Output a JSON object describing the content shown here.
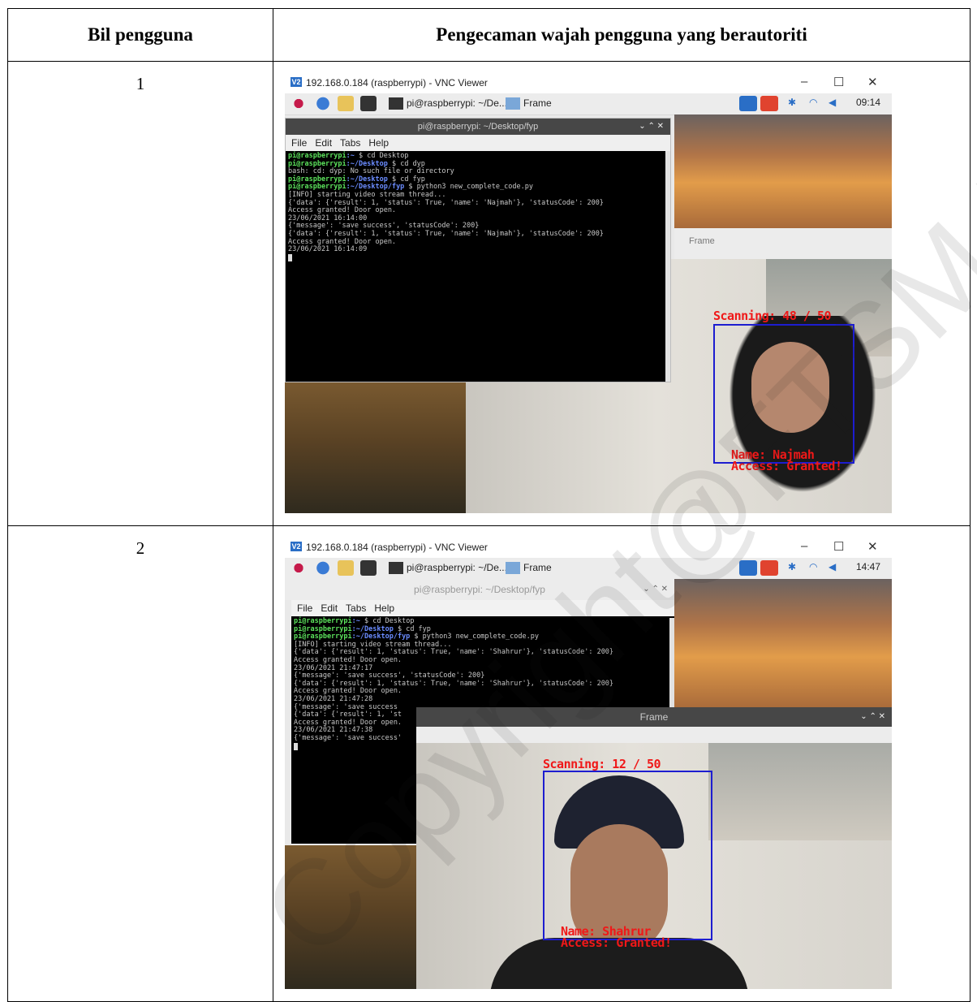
{
  "table": {
    "col1_header": "Bil pengguna",
    "col2_header": "Pengecaman wajah pengguna yang berautoriti"
  },
  "rows": [
    {
      "number": "1",
      "vnc_title": "192.168.0.184 (raspberrypi) - VNC Viewer",
      "taskbar_terminal": "pi@raspberrypi: ~/De...",
      "taskbar_frame": "Frame",
      "clock": "09:14",
      "terminal_title": "pi@raspberrypi: ~/Desktop/fyp",
      "terminal_menu": [
        "File",
        "Edit",
        "Tabs",
        "Help"
      ],
      "terminal_lines": [
        {
          "prompt": "pi@raspberrypi",
          "path": ":~",
          "cmd": " $ cd Desktop"
        },
        {
          "prompt": "pi@raspberrypi",
          "path": ":~/Desktop",
          "cmd": " $ cd dyp"
        },
        {
          "text": "bash: cd: dyp: No such file or directory"
        },
        {
          "prompt": "pi@raspberrypi",
          "path": ":~/Desktop",
          "cmd": " $ cd fyp"
        },
        {
          "prompt": "pi@raspberrypi",
          "path": ":~/Desktop/fyp",
          "cmd": " $ python3 new_complete_code.py"
        },
        {
          "text": "[INFO] starting video stream thread..."
        },
        {
          "text": "{'data': {'result': 1, 'status': True, 'name': 'Najmah'}, 'statusCode': 200}"
        },
        {
          "text": "Access granted! Door open."
        },
        {
          "text": "23/06/2021 16:14:00"
        },
        {
          "text": "{'message': 'save success', 'statusCode': 200}"
        },
        {
          "text": "{'data': {'result': 1, 'status': True, 'name': 'Najmah'}, 'statusCode': 200}"
        },
        {
          "text": "Access granted! Door open."
        },
        {
          "text": "23/06/2021 16:14:09"
        }
      ],
      "frame_label": "Frame",
      "overlay_scanning": "Scanning: 48 / 50",
      "overlay_name": "Name: Najmah",
      "overlay_access": "Access: Granted!"
    },
    {
      "number": "2",
      "vnc_title": "192.168.0.184 (raspberrypi) - VNC Viewer",
      "taskbar_terminal": "pi@raspberrypi: ~/De...",
      "taskbar_frame": "Frame",
      "clock": "14:47",
      "terminal_title": "pi@raspberrypi: ~/Desktop/fyp",
      "terminal_menu": [
        "File",
        "Edit",
        "Tabs",
        "Help"
      ],
      "terminal_lines": [
        {
          "prompt": "pi@raspberrypi",
          "path": ":~",
          "cmd": " $ cd Desktop"
        },
        {
          "prompt": "pi@raspberrypi",
          "path": ":~/Desktop",
          "cmd": " $ cd fyp"
        },
        {
          "prompt": "pi@raspberrypi",
          "path": ":~/Desktop/fyp",
          "cmd": " $ python3 new_complete_code.py"
        },
        {
          "text": "[INFO] starting video stream thread..."
        },
        {
          "text": "{'data': {'result': 1, 'status': True, 'name': 'Shahrur'}, 'statusCode': 200}"
        },
        {
          "text": "Access granted! Door open."
        },
        {
          "text": "23/06/2021 21:47:17"
        },
        {
          "text": "{'message': 'save success', 'statusCode': 200}"
        },
        {
          "text": "{'data': {'result': 1, 'status': True, 'name': 'Shahrur'}, 'statusCode': 200}"
        },
        {
          "text": "Access granted! Door open."
        },
        {
          "text": "23/06/2021 21:47:28"
        },
        {
          "text": "{'message': 'save success"
        },
        {
          "text": "{'data': {'result': 1, 'st"
        },
        {
          "text": "Access granted! Door open."
        },
        {
          "text": "23/06/2021 21:47:38"
        },
        {
          "text": "{'message': 'save success'"
        }
      ],
      "frame_label": "Frame",
      "overlay_scanning": "Scanning: 12 / 50",
      "overlay_name": "Name: Shahrur",
      "overlay_access": "Access: Granted!"
    }
  ],
  "watermark": "Copyright@FTSM UKM"
}
